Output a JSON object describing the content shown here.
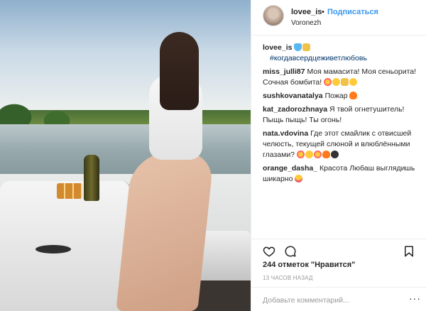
{
  "header": {
    "username": "lovee_is",
    "dot": "•",
    "follow_label": "Подписаться",
    "location": "Voronezh"
  },
  "caption": {
    "user": "lovee_is",
    "hashtag": "#когдавсердцеживетлюбовь"
  },
  "comments": [
    {
      "user": "miss_julli87",
      "text": "Моя мамасита! Моя сеньорита! Сочная бомбита!"
    },
    {
      "user": "sushkovanatalya",
      "text": "Пожар"
    },
    {
      "user": "kat_zadorozhnaya",
      "text": "Я твой огнетушитель! Пыщь пыщь! Ты огонь!"
    },
    {
      "user": "nata.vdovina",
      "text": "Где этот смайлик с отвисшей челюсть, текущей слюной и влюблёнными глазами?"
    },
    {
      "user": "orange_dasha_",
      "text": "Красота Любаш выглядишь шикарно"
    }
  ],
  "stats": {
    "likes": "244 отметок \"Нравится\"",
    "time": "13 ЧАСОВ НАЗАД"
  },
  "add_comment": {
    "placeholder": "Добавьте комментарий...",
    "more": "···"
  },
  "colors": {
    "accent": "#3897f0",
    "text": "#262626",
    "muted": "#999999",
    "divider": "#efefef"
  },
  "icons": [
    "heart-icon",
    "comment-icon",
    "bookmark-icon",
    "more-options-icon"
  ]
}
